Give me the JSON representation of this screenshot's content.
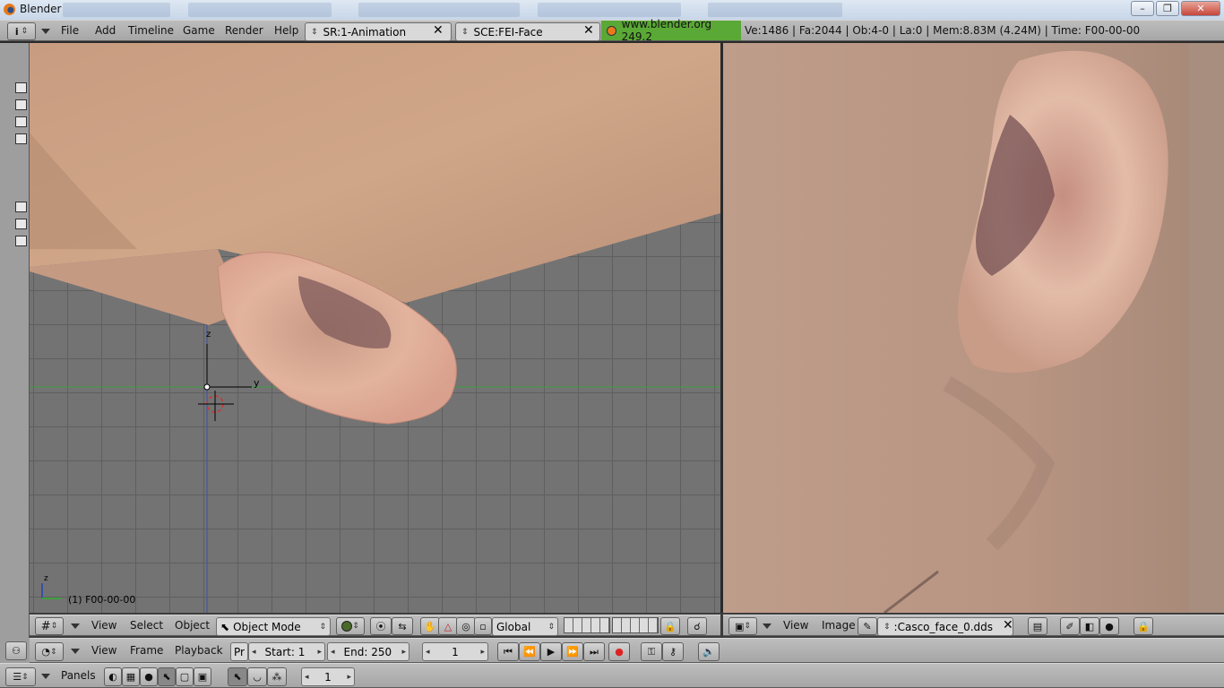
{
  "window": {
    "title": "Blender"
  },
  "topbar": {
    "menus": [
      "File",
      "Add",
      "Timeline",
      "Game",
      "Render",
      "Help"
    ],
    "screen": "SR:1-Animation",
    "scene": "SCE:FEI-Face",
    "version": "www.blender.org 249.2",
    "stats": "Ve:1486 | Fa:2044 | Ob:4-0 | La:0  | Mem:8.83M (4.24M)  | Time: F00-00-00"
  },
  "viewport3d": {
    "frame_label": "(1) F00-00-00",
    "axis_z": "z",
    "axis_y": "y",
    "header": {
      "menus": [
        "View",
        "Select",
        "Object"
      ],
      "mode": "Object Mode",
      "orientation": "Global"
    }
  },
  "image_editor": {
    "header": {
      "menus": [
        "View",
        "Image"
      ],
      "image_name": ":Casco_face_0.dds"
    }
  },
  "timeline": {
    "menus": [
      "View",
      "Frame",
      "Playback"
    ],
    "pr": "Pr",
    "start": "Start: 1",
    "end": "End: 250",
    "current": "1"
  },
  "buttons_window": {
    "panels_label": "Panels",
    "value": "1"
  },
  "colors": {
    "header": "#b0b0b0",
    "viewport": "#737373",
    "grid": "#5f5f5f",
    "stats_green": "#5aa835",
    "x_axis": "#3fa03f",
    "z_axis": "#3b4fa0"
  }
}
